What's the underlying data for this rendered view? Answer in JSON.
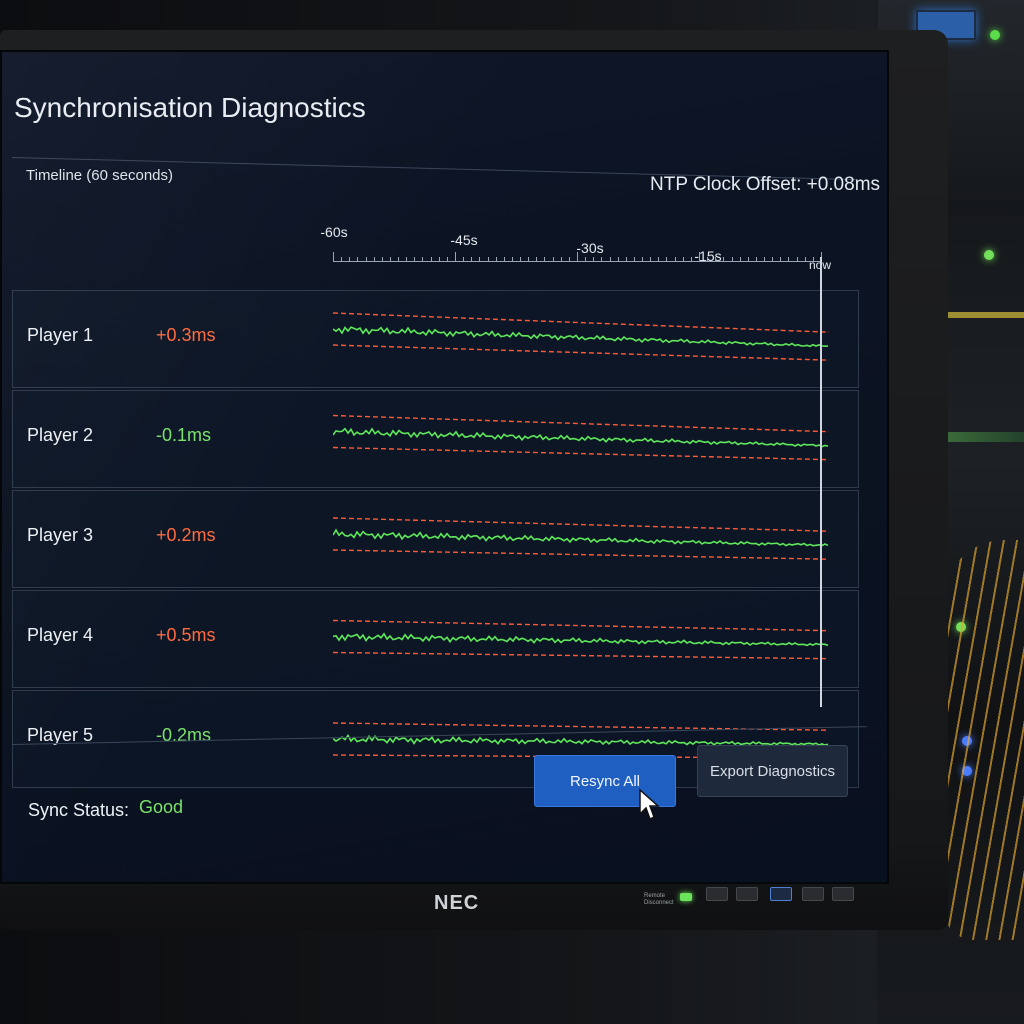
{
  "window": {
    "title": "Synchronisation Diagnostics",
    "timeline_label": "Timeline (60 seconds)",
    "ntp_offset": "NTP Clock Offset: +0.08ms"
  },
  "timeline": {
    "ticks": [
      "-60s",
      "-45s",
      "-30s",
      "-15s",
      "now"
    ]
  },
  "players": [
    {
      "name": "Player 1",
      "offset": "+0.3ms",
      "status_color": "#ff6a3d"
    },
    {
      "name": "Player 2",
      "offset": "-0.1ms",
      "status_color": "#7be36a"
    },
    {
      "name": "Player 3",
      "offset": "+0.2ms",
      "status_color": "#ff6a3d"
    },
    {
      "name": "Player 4",
      "offset": "+0.5ms",
      "status_color": "#ff6a3d"
    },
    {
      "name": "Player 5",
      "offset": "-0.2ms",
      "status_color": "#7be36a"
    }
  ],
  "status": {
    "label": "Sync Status:",
    "value": "Good",
    "value_color": "#7be36a"
  },
  "actions": {
    "resync_label": "Resync All",
    "export_label": "Export Diagnostics"
  },
  "monitor": {
    "brand": "NEC",
    "hw_labels": "Remote Disconnect"
  },
  "colors": {
    "trace": "#5ee85a",
    "threshold": "#ff5a36",
    "accent": "#1f5fc2"
  }
}
